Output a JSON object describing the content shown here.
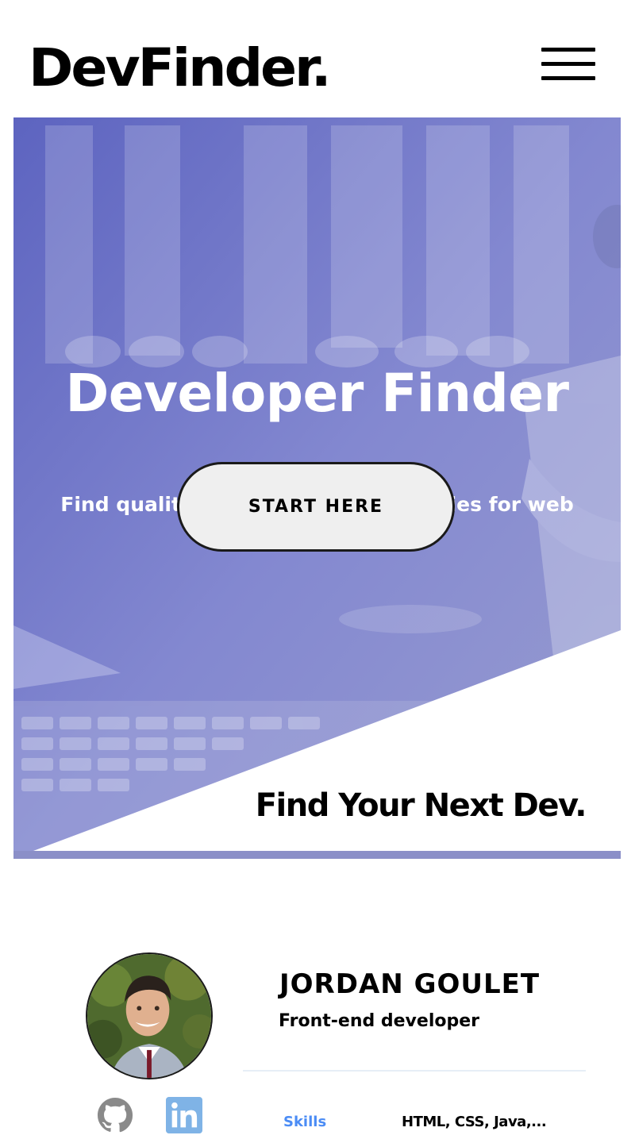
{
  "header": {
    "logo": "DevFinder.",
    "menu_icon": "hamburger-menu-icon"
  },
  "hero": {
    "title": "Developer Finder",
    "subtitle": "Find quality freelancers and agencies for web development",
    "cta_label": "START HERE",
    "tagline": "Find Your Next Dev.",
    "overlay_color": "#7a80cc"
  },
  "developer": {
    "name": "JORDAN GOULET",
    "role": "Front-end developer",
    "skills_label": "Skills",
    "skills_value": "HTML, CSS, Java,...",
    "social": [
      "github-icon",
      "linkedin-icon"
    ]
  },
  "colors": {
    "accent_blue": "#4b8cf5",
    "linkedin_blue": "#7fb3e6",
    "github_gray": "#8a8a8a"
  }
}
